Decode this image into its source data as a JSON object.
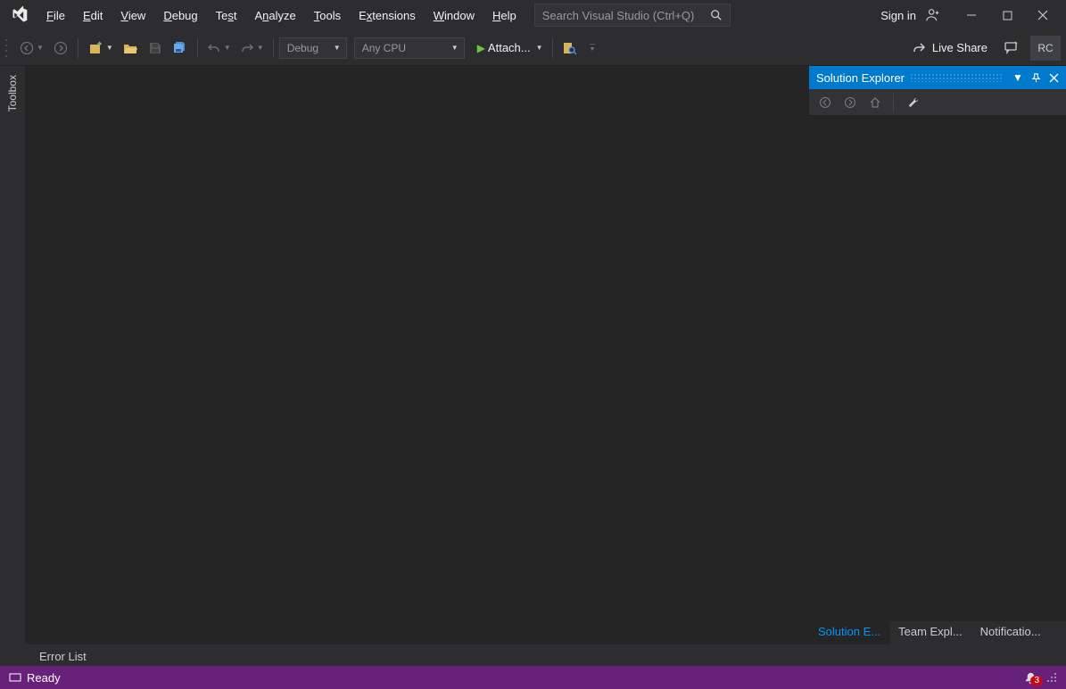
{
  "menu": {
    "file": "File",
    "edit": "Edit",
    "view": "View",
    "debug": "Debug",
    "test": "Test",
    "analyze": "Analyze",
    "tools": "Tools",
    "extensions": "Extensions",
    "window": "Window",
    "help": "Help"
  },
  "search": {
    "placeholder": "Search Visual Studio (Ctrl+Q)"
  },
  "signin": {
    "label": "Sign in"
  },
  "toolbar": {
    "config": "Debug",
    "platform": "Any CPU",
    "attach": "Attach...",
    "liveshare": "Live Share",
    "badge": "RC"
  },
  "left_panel": {
    "toolbox": "Toolbox"
  },
  "solution_explorer": {
    "title": "Solution Explorer",
    "tabs": {
      "solution": "Solution E...",
      "team": "Team Expl...",
      "notifications": "Notificatio..."
    }
  },
  "bottom": {
    "error_list": "Error List"
  },
  "status": {
    "ready": "Ready",
    "notif_count": "3"
  }
}
